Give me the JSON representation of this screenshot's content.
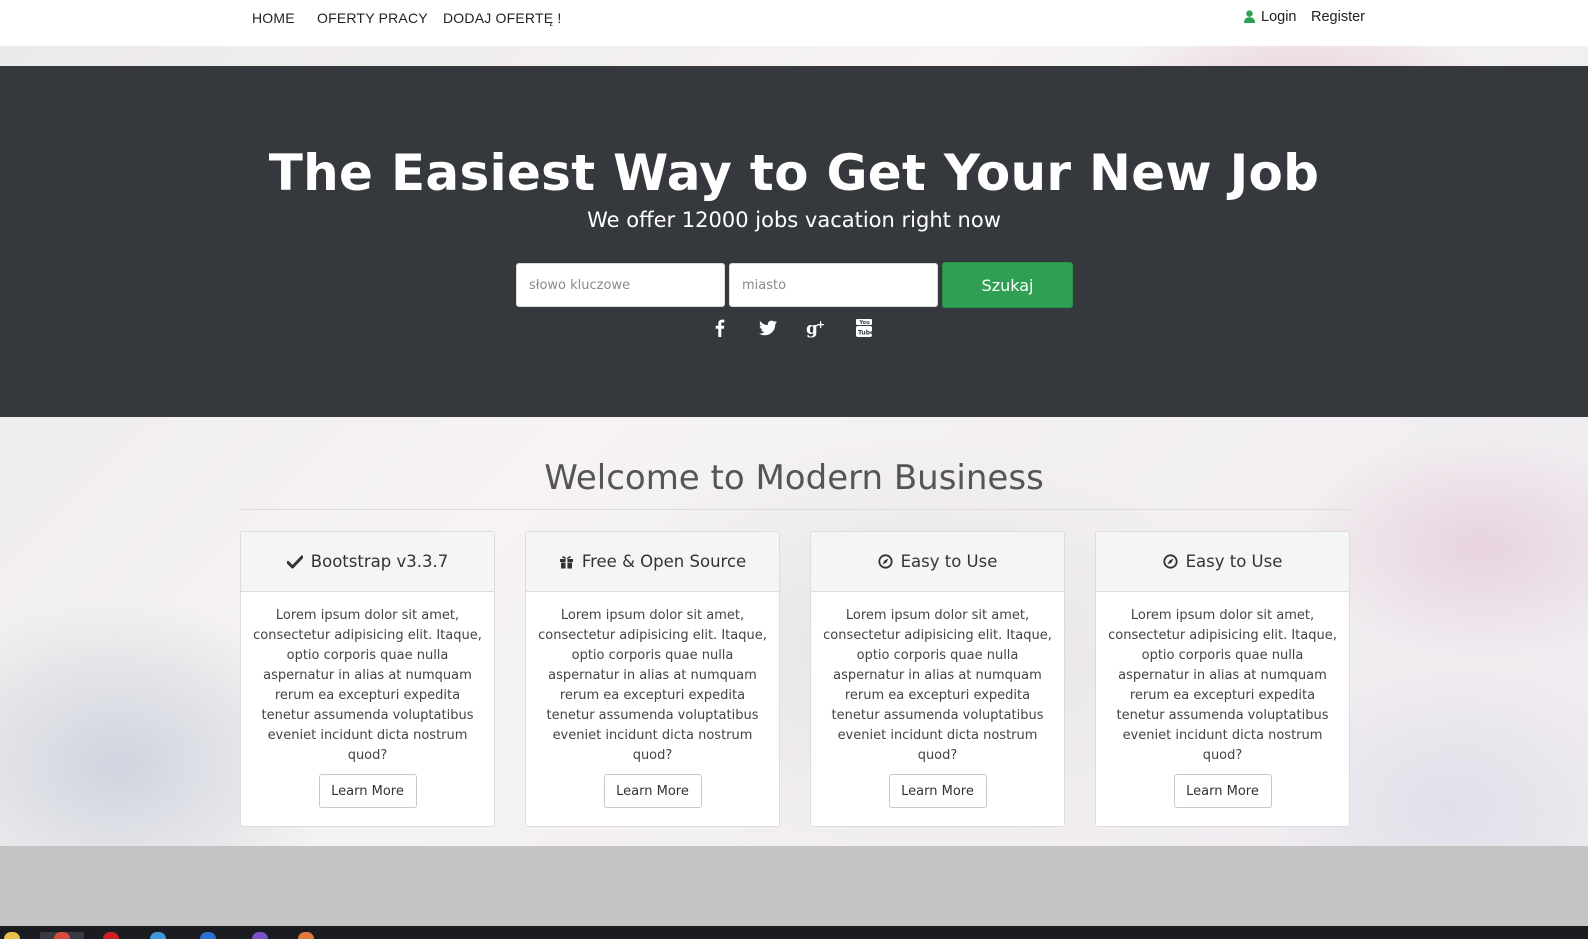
{
  "nav": {
    "home": "HOME",
    "offers": "OFERTY PRACY",
    "add_offer": "DODAJ OFERTĘ !",
    "login": "Login",
    "register": "Register"
  },
  "hero": {
    "title": "The Easiest Way to Get Your New Job",
    "subtitle": "We offer 12000 jobs vacation right now",
    "keyword_placeholder": "słowo kluczowe",
    "city_placeholder": "miasto",
    "search_button": "Szukaj",
    "social_icons": [
      "facebook-icon",
      "twitter-icon",
      "google-plus-icon",
      "youtube-icon"
    ]
  },
  "section": {
    "title": "Welcome to Modern Business"
  },
  "cards": [
    {
      "icon": "check-icon",
      "title": "Bootstrap v3.3.7",
      "text": "Lorem ipsum dolor sit amet, consectetur adipisicing elit. Itaque, optio corporis quae nulla aspernatur in alias at numquam rerum ea excepturi expedita tenetur assumenda voluptatibus eveniet incidunt dicta nostrum quod?",
      "button": "Learn More"
    },
    {
      "icon": "gift-icon",
      "title": "Free & Open Source",
      "text": "Lorem ipsum dolor sit amet, consectetur adipisicing elit. Itaque, optio corporis quae nulla aspernatur in alias at numquam rerum ea excepturi expedita tenetur assumenda voluptatibus eveniet incidunt dicta nostrum quod?",
      "button": "Learn More"
    },
    {
      "icon": "compass-icon",
      "title": "Easy to Use",
      "text": "Lorem ipsum dolor sit amet, consectetur adipisicing elit. Itaque, optio corporis quae nulla aspernatur in alias at numquam rerum ea excepturi expedita tenetur assumenda voluptatibus eveniet incidunt dicta nostrum quod?",
      "button": "Learn More"
    },
    {
      "icon": "compass-icon",
      "title": "Easy to Use",
      "text": "Lorem ipsum dolor sit amet, consectetur adipisicing elit. Itaque, optio corporis quae nulla aspernatur in alias at numquam rerum ea excepturi expedita tenetur assumenda voluptatibus eveniet incidunt dicta nostrum quod?",
      "button": "Learn More"
    }
  ],
  "colors": {
    "hero_bg": "#35393e",
    "accent_green": "#2fa053",
    "user_icon": "#2fa053"
  }
}
